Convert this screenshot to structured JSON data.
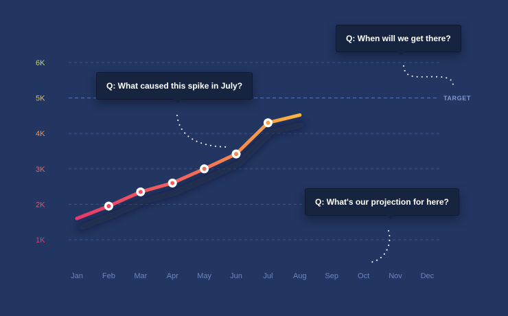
{
  "chart_data": {
    "type": "line",
    "categories": [
      "Jan",
      "Feb",
      "Mar",
      "Apr",
      "May",
      "Jun",
      "Jul",
      "Aug",
      "Sep",
      "Oct",
      "Nov",
      "Dec"
    ],
    "values": [
      1600,
      1950,
      2350,
      2600,
      3000,
      3420,
      4300,
      4520
    ],
    "ylim": [
      0,
      6500
    ],
    "y_ticks": [
      {
        "value": 1000,
        "label": "1K",
        "color": "#e8396a"
      },
      {
        "value": 2000,
        "label": "2K",
        "color": "#ef4f66"
      },
      {
        "value": 3000,
        "label": "3K",
        "color": "#f1685a"
      },
      {
        "value": 4000,
        "label": "4K",
        "color": "#f4914a"
      },
      {
        "value": 5000,
        "label": "5K",
        "color": "#f3b945"
      },
      {
        "value": 6000,
        "label": "6K",
        "color": "#c6d36a"
      }
    ],
    "target": {
      "value": 5000,
      "label": "TARGET"
    },
    "marker_indices": [
      1,
      2,
      3,
      4,
      5,
      6
    ],
    "line_gradient": [
      "#e8396a",
      "#f1685a",
      "#f9b63d"
    ],
    "grid": true,
    "annotations": {
      "spike": "Q: What caused this spike in July?",
      "target": "Q: When will we get there?",
      "projection": "Q: What's our projection for here?"
    }
  },
  "colors": {
    "background": "#233661",
    "grid": "#3a5490",
    "target_line": "#5d7bc2",
    "callout_bg": "#172440"
  }
}
